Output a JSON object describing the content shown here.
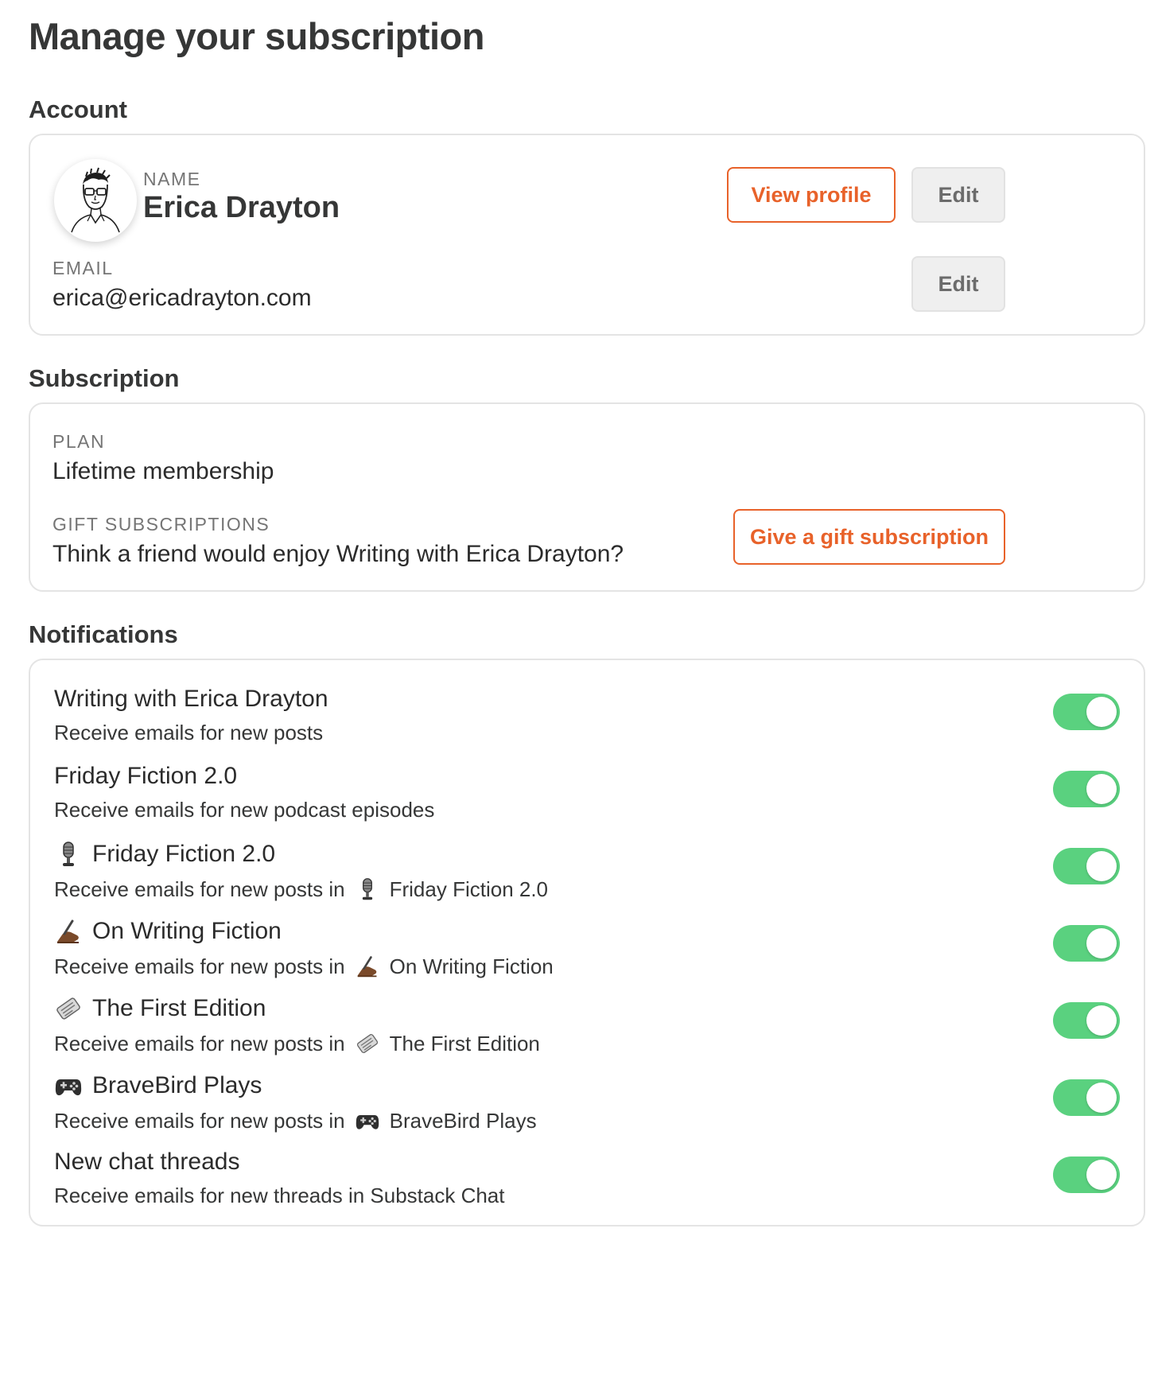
{
  "page": {
    "title": "Manage your subscription"
  },
  "account": {
    "section_title": "Account",
    "name_label": "NAME",
    "name_value": "Erica Drayton",
    "view_profile_label": "View profile",
    "edit_name_label": "Edit",
    "email_label": "EMAIL",
    "email_value": "erica@ericadrayton.com",
    "edit_email_label": "Edit"
  },
  "subscription": {
    "section_title": "Subscription",
    "plan_label": "PLAN",
    "plan_value": "Lifetime membership",
    "gift_label": "GIFT SUBSCRIPTIONS",
    "gift_text": "Think a friend would enjoy Writing with Erica Drayton?",
    "gift_button_label": "Give a gift subscription"
  },
  "notifications": {
    "section_title": "Notifications",
    "items": [
      {
        "title": "Writing with Erica Drayton",
        "subtitle": "Receive emails for new posts",
        "icon": "",
        "enabled": true
      },
      {
        "title": "Friday Fiction 2.0",
        "subtitle": "Receive emails for new podcast episodes",
        "icon": "",
        "enabled": true
      },
      {
        "title": "Friday Fiction 2.0",
        "subtitle": "Receive emails for new posts in",
        "subtitle_tail": "Friday Fiction 2.0",
        "icon": "microphone-icon",
        "enabled": true
      },
      {
        "title": "On Writing Fiction",
        "subtitle": "Receive emails for new posts in",
        "subtitle_tail": "On Writing Fiction",
        "icon": "writing-hand-icon",
        "enabled": true
      },
      {
        "title": "The First Edition",
        "subtitle": "Receive emails for new posts in",
        "subtitle_tail": "The First Edition",
        "icon": "newspaper-icon",
        "enabled": true
      },
      {
        "title": "BraveBird Plays",
        "subtitle": "Receive emails for new posts in",
        "subtitle_tail": "BraveBird Plays",
        "icon": "game-controller-icon",
        "enabled": true
      },
      {
        "title": "New chat threads",
        "subtitle": "Receive emails for new threads in Substack Chat",
        "icon": "",
        "enabled": true
      }
    ]
  },
  "colors": {
    "accent": "#e8622a",
    "toggle_on": "#5ad17f",
    "card_border": "#e4e4e4",
    "text_primary": "#363737",
    "text_muted": "#757575"
  }
}
